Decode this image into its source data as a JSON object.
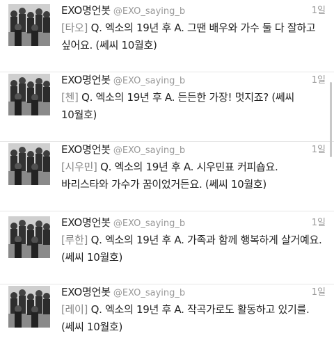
{
  "colors": {
    "name": "#1f1f1f",
    "handle": "#999999",
    "time": "#9a9a9a",
    "text": "#222222",
    "divider": "#e6e6e6"
  },
  "tweets": [
    {
      "author": "EXO명언봇",
      "handle": "@EXO_saying_b",
      "time": "1일",
      "member": "[타오]",
      "text": " Q. 엑소의 19년 후 A. 그땐 배우와 가수 둘 다 잘하고 싶어요. (쎄씨 10월호)"
    },
    {
      "author": "EXO명언봇",
      "handle": "@EXO_saying_b",
      "time": "1일",
      "member": "[첸]",
      "text": " Q. 엑소의 19년 후 A. 든든한 가장! 멋지죠? (쎄씨 10월호)"
    },
    {
      "author": "EXO명언봇",
      "handle": "@EXO_saying_b",
      "time": "1일",
      "member": "[시우민]",
      "text": " Q. 엑소의 19년 후 A. 시우민표 커피숍요. 바리스타와 가수가 꿈이었거든요. (쎄씨 10월호)"
    },
    {
      "author": "EXO명언봇",
      "handle": "@EXO_saying_b",
      "time": "1일",
      "member": "[루한]",
      "text": " Q. 엑소의 19년 후 A. 가족과 함께 행복하게 살거예요. (쎄씨 10월호)"
    },
    {
      "author": "EXO명언봇",
      "handle": "@EXO_saying_b",
      "time": "1일",
      "member": "[레이]",
      "text": " Q. 엑소의 19년 후 A. 작곡가로도 활동하고 있기를. (쎄씨 10월호)"
    }
  ]
}
